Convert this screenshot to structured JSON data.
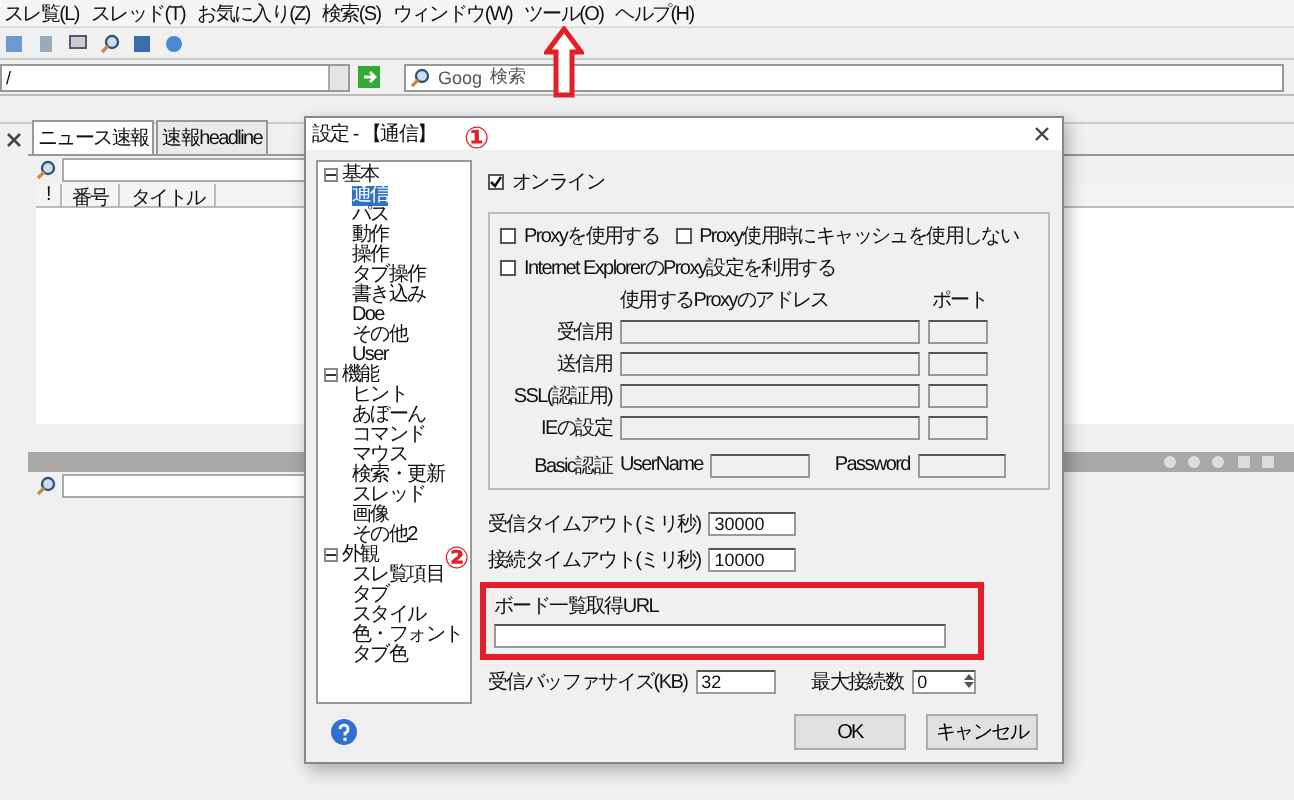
{
  "menu": [
    "スレ覧(L)",
    "スレッド(T)",
    "お気に入り(Z)",
    "検索(S)",
    "ウィンドウ(W)",
    "ツール(O)",
    "ヘルプ(H)"
  ],
  "address": {
    "value": "/"
  },
  "search": {
    "value": "Goog",
    "button": "検索"
  },
  "left_panel": {
    "tabs": [
      {
        "label": "ニュース速報",
        "selected": true
      },
      {
        "label": "速報headline",
        "selected": false
      }
    ],
    "columns": [
      "!",
      "番号",
      "タイトル"
    ]
  },
  "dialog": {
    "title": "設定 - 【通信】",
    "tree": [
      {
        "label": "基本",
        "expanded": true,
        "children": [
          {
            "label": "通信",
            "selected": true
          },
          {
            "label": "パス",
            "selected": false
          },
          {
            "label": "動作",
            "selected": false
          },
          {
            "label": "操作",
            "selected": false
          },
          {
            "label": "タブ操作",
            "selected": false
          },
          {
            "label": "書き込み",
            "selected": false
          },
          {
            "label": "Doe",
            "selected": false
          },
          {
            "label": "その他",
            "selected": false
          },
          {
            "label": "User",
            "selected": false
          }
        ]
      },
      {
        "label": "機能",
        "expanded": true,
        "children": [
          {
            "label": "ヒント",
            "selected": false
          },
          {
            "label": "あぼーん",
            "selected": false
          },
          {
            "label": "コマンド",
            "selected": false
          },
          {
            "label": "マウス",
            "selected": false
          },
          {
            "label": "検索・更新",
            "selected": false
          },
          {
            "label": "スレッド",
            "selected": false
          },
          {
            "label": "画像",
            "selected": false
          },
          {
            "label": "その他2",
            "selected": false
          }
        ]
      },
      {
        "label": "外観",
        "expanded": true,
        "children": [
          {
            "label": "スレ覧項目",
            "selected": false
          },
          {
            "label": "タブ",
            "selected": false
          },
          {
            "label": "スタイル",
            "selected": false
          },
          {
            "label": "色・フォント",
            "selected": false
          },
          {
            "label": "タブ色",
            "selected": false
          }
        ]
      }
    ],
    "online": {
      "label": "オンライン",
      "checked": true
    },
    "proxy_options": [
      {
        "label": "Proxyを使用する",
        "checked": false
      },
      {
        "label": "Proxy使用時にキャッシュを使用しない",
        "checked": false
      }
    ],
    "ie_proxy": {
      "label": "Internet ExplorerのProxy設定を利用する",
      "checked": false
    },
    "proxy_header": {
      "address": "使用するProxyのアドレス",
      "port": "ポート"
    },
    "proxy_rows": [
      {
        "label": "受信用"
      },
      {
        "label": "送信用"
      },
      {
        "label": "SSL(認証用)"
      },
      {
        "label": "IEの設定"
      }
    ],
    "basic_auth": {
      "label": "Basic認証",
      "username": "UserName",
      "password": "Password"
    },
    "receive_timeout": {
      "label": "受信タイムアウト(ミリ秒)",
      "value": "30000"
    },
    "connect_timeout": {
      "label": "接続タイムアウト(ミリ秒)",
      "value": "10000"
    },
    "board_url": {
      "label": "ボード一覧取得URL"
    },
    "buffer_size": {
      "label": "受信バッファサイズ(KB)",
      "value": "32"
    },
    "max_connections": {
      "label": "最大接続数",
      "value": "0"
    },
    "buttons": [
      "OK",
      "キャンセル"
    ]
  },
  "annotations": [
    "①",
    "②"
  ]
}
